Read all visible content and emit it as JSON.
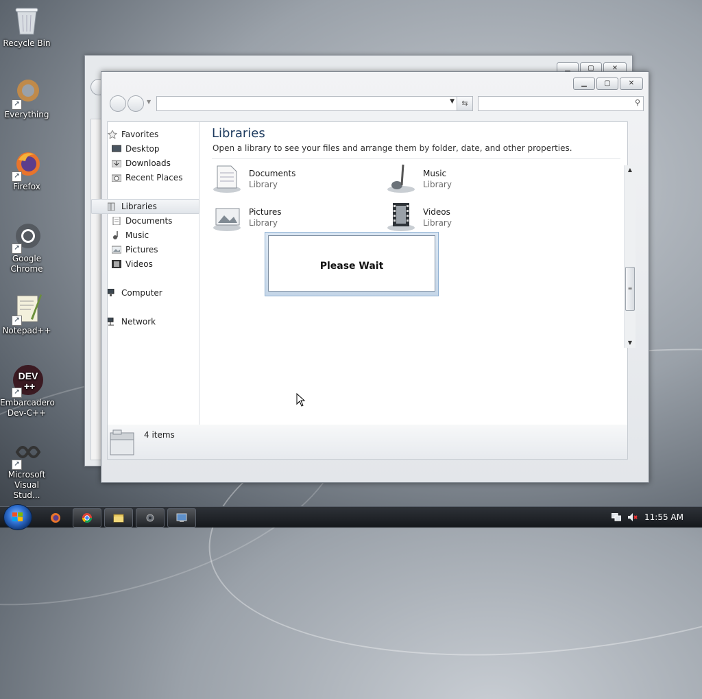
{
  "desktop": {
    "icons": [
      {
        "label": "Recycle Bin"
      },
      {
        "label": "Everything"
      },
      {
        "label": "Firefox"
      },
      {
        "label": "Google Chrome"
      },
      {
        "label": "Notepad++"
      },
      {
        "label": "Embarcadero Dev-C++"
      },
      {
        "label": "Microsoft Visual Stud..."
      }
    ]
  },
  "explorer": {
    "address_value": "",
    "search_placeholder": "",
    "sidebar": {
      "favorites": "Favorites",
      "desktop": "Desktop",
      "downloads": "Downloads",
      "recent": "Recent Places",
      "libraries": "Libraries",
      "documents": "Documents",
      "music": "Music",
      "pictures": "Pictures",
      "videos": "Videos",
      "computer": "Computer",
      "network": "Network"
    },
    "main": {
      "title": "Libraries",
      "subtitle": "Open a library to see your files and arrange them by folder, date, and other properties.",
      "items": [
        {
          "name": "Documents",
          "type": "Library",
          "icon": "documents-library-icon"
        },
        {
          "name": "Music",
          "type": "Library",
          "icon": "music-library-icon"
        },
        {
          "name": "Pictures",
          "type": "Library",
          "icon": "pictures-library-icon"
        },
        {
          "name": "Videos",
          "type": "Library",
          "icon": "videos-library-icon"
        }
      ]
    },
    "status": {
      "count": "4 items"
    }
  },
  "dialog": {
    "text": "Please Wait"
  },
  "taskbar": {
    "clock": "11:55 AM",
    "pinned": [
      "firefox-icon",
      "chrome-icon",
      "explorer-icon",
      "settings-icon",
      "remote-desktop-icon"
    ]
  },
  "colors": {
    "accent": "#1c3a5e",
    "taskbar": "#1e2226",
    "selection": "#e1e5ea"
  }
}
